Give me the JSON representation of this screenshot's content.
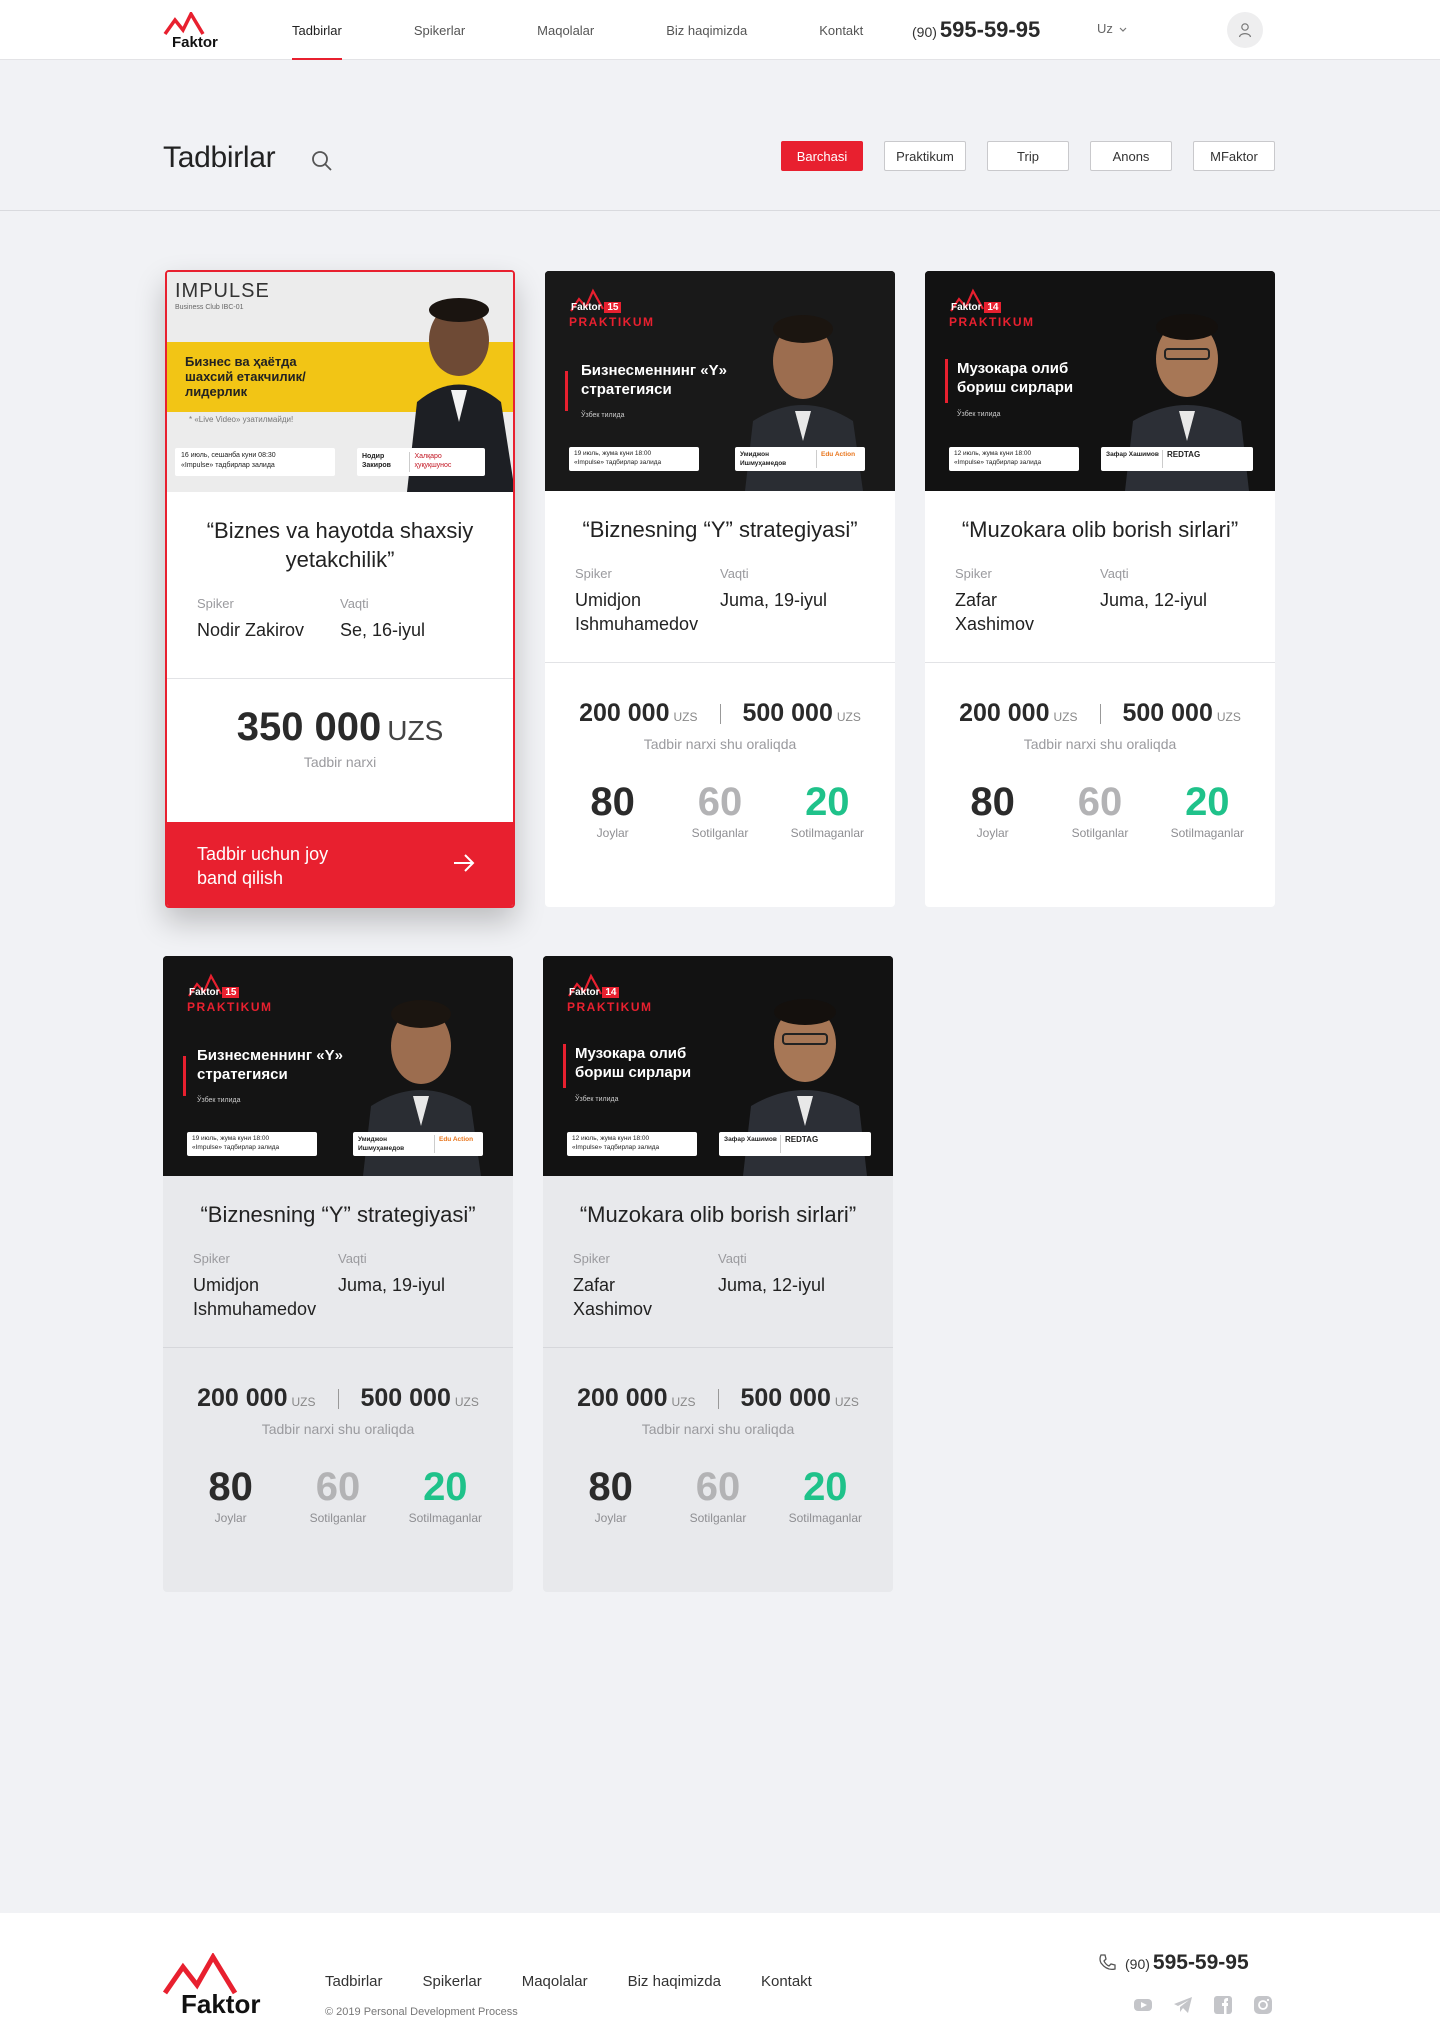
{
  "header": {
    "logo_text": "Faktor",
    "nav": [
      "Tadbirlar",
      "Spikerlar",
      "Maqolalar",
      "Biz haqimizda",
      "Kontakt"
    ],
    "phone_code": "(90)",
    "phone_number": "595-59-95",
    "language": "Uz"
  },
  "page": {
    "title": "Tadbirlar",
    "filters": [
      "Barchasi",
      "Praktikum",
      "Trip",
      "Anons",
      "MFaktor"
    ],
    "active_filter": "Barchasi"
  },
  "labels": {
    "speaker": "Spiker",
    "time": "Vaqti",
    "price_note": "Tadbir narxi",
    "price_range_note": "Tadbir narxi shu oraliqda",
    "seats": "Joylar",
    "sold": "Sotilganlar",
    "unsold": "Sotilmaganlar",
    "currency": "UZS",
    "book": "Tadbir uchun joy band qilish"
  },
  "events": [
    {
      "title": "“Biznes va hayotda shaxsiy yetakchilik”",
      "speaker": "Nodir Zakirov",
      "date": "Se, 16-iyul",
      "price": "350 000",
      "banner": {
        "style": "impulse",
        "brand": "IMPULSE",
        "sub": "Business Club",
        "code": "IBC-01",
        "heading": "Бизнес ва ҳаётда шахсий етакчилик/лидерлик",
        "note": "* «Live Video» узатилмайди!",
        "info1": "16 июль, сешанба куни  08:30",
        "info2": "«Impulse» тадбирлар залида",
        "person": "Нодир Закиров",
        "role": "Халқаро ҳуқуқшунос"
      }
    },
    {
      "title": "“Biznesning “Y” strategiyasi”",
      "speaker": "Umidjon Ishmuhamedov",
      "date": "Juma, 19-iyul",
      "price_min": "200 000",
      "price_max": "500 000",
      "seats": 80,
      "sold": 60,
      "unsold": 20,
      "banner": {
        "style": "praktikum",
        "num": "15",
        "brand": "Faktor",
        "program": "PRAKTIKUM",
        "heading": "Бизнесменнинг «Y» стратегияси",
        "lang": "Ўзбек тилида",
        "info1": "19 июль, жума куни  18:00",
        "info2": "«Impulse» тадбирлар залида",
        "person": "Умиджон Ишмуҳамедов",
        "partner": "Edu Action"
      }
    },
    {
      "title": "“Muzokara olib borish sirlari”",
      "speaker": "Zafar Xashimov",
      "date": "Juma, 12-iyul",
      "price_min": "200 000",
      "price_max": "500 000",
      "seats": 80,
      "sold": 60,
      "unsold": 20,
      "banner": {
        "style": "praktikum",
        "num": "14",
        "brand": "Faktor",
        "program": "PRAKTIKUM",
        "heading": "Музокара олиб бориш сирлари",
        "lang": "Ўзбек тилида",
        "info1": "12 июль, жума куни  18:00",
        "info2": "«Impulse» тадбирлар залида",
        "person": "Зафар Хашимов",
        "partner": "REDTAG"
      }
    },
    {
      "title": "“Biznesning “Y” strategiyasi”",
      "speaker": "Umidjon Ishmuhamedov",
      "date": "Juma, 19-iyul",
      "price_min": "200 000",
      "price_max": "500 000",
      "seats": 80,
      "sold": 60,
      "unsold": 20,
      "banner": {
        "style": "praktikum",
        "num": "15",
        "brand": "Faktor",
        "program": "PRAKTIKUM",
        "heading": "Бизнесменнинг «Y» стратегияси",
        "lang": "Ўзбек тилида",
        "info1": "19 июль, жума куни  18:00",
        "info2": "«Impulse» тадбирлар залида",
        "person": "Умиджон Ишмуҳамедов",
        "partner": "Edu Action"
      }
    },
    {
      "title": "“Muzokara olib borish sirlari”",
      "speaker": "Zafar Xashimov",
      "date": "Juma, 12-iyul",
      "price_min": "200 000",
      "price_max": "500 000",
      "seats": 80,
      "sold": 60,
      "unsold": 20,
      "banner": {
        "style": "praktikum",
        "num": "14",
        "brand": "Faktor",
        "program": "PRAKTIKUM",
        "heading": "Музокара олиб бориш сирлари",
        "lang": "Ўзбек тилида",
        "info1": "12 июль, жума куни  18:00",
        "info2": "«Impulse» тадбирлар залида",
        "person": "Зафар Хашимов",
        "partner": "REDTAG"
      }
    }
  ],
  "footer": {
    "logo_text": "Faktor",
    "nav": [
      "Tadbirlar",
      "Spikerlar",
      "Maqolalar",
      "Biz haqimizda",
      "Kontakt"
    ],
    "copyright": "© 2019 Personal Development Process",
    "phone_code": "(90)",
    "phone_number": "595-59-95",
    "socials": [
      "youtube-icon",
      "telegram-icon",
      "facebook-icon",
      "instagram-icon"
    ]
  },
  "colors": {
    "accent": "#e8202f",
    "sold": "#b3b3b5",
    "unsold": "#1fc28a",
    "page_bg": "#f1f2f5"
  }
}
